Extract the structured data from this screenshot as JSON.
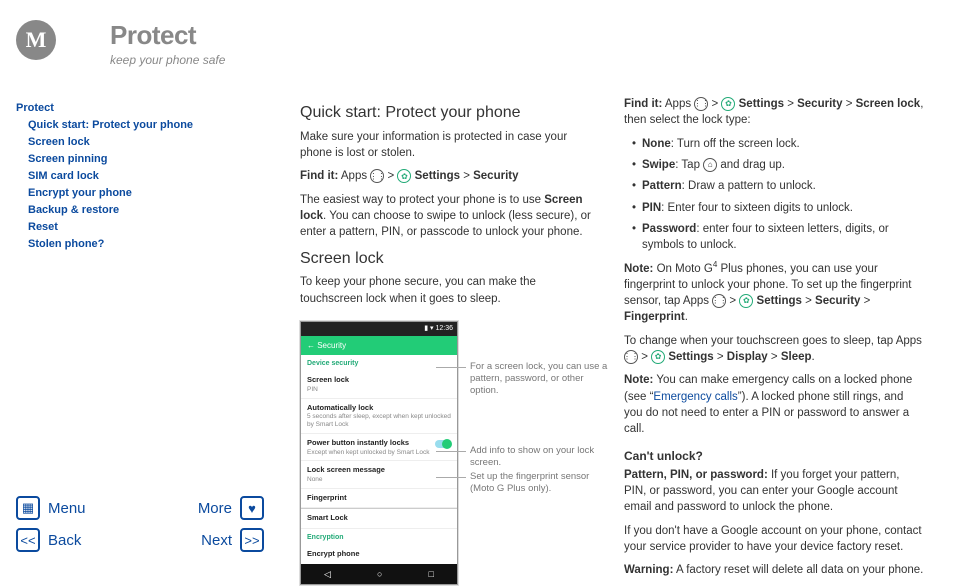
{
  "header": {
    "title": "Protect",
    "subtitle": "keep your phone safe"
  },
  "toc": {
    "head": "Protect",
    "items": [
      "Quick start: Protect your phone",
      "Screen lock",
      "Screen pinning",
      "SIM card lock",
      "Encrypt your phone",
      "Backup & restore",
      "Reset",
      "Stolen phone?"
    ]
  },
  "nav": {
    "menu": "Menu",
    "more": "More",
    "back": "Back",
    "next": "Next"
  },
  "col1": {
    "h_quick": "Quick start: Protect your phone",
    "p_intro": "Make sure your information is protected in case your phone is lost or stolen.",
    "findit_label": "Find it:",
    "findit_apps": "Apps",
    "findit_settings": "Settings",
    "findit_security": "Security",
    "p_easiest1": "The easiest way to protect your phone is to use ",
    "screen_lock_bold": "Screen lock",
    "p_easiest2": ". You can choose to swipe to unlock (less secure), or enter a pattern, PIN, or passcode to unlock your phone.",
    "h_screenlock": "Screen lock",
    "p_screenlock": "To keep your phone secure, you can make the touchscreen lock when it goes to sleep."
  },
  "phone": {
    "time": "12:36",
    "appbar": "←   Security",
    "sect1": "Device security",
    "r1_t": "Screen lock",
    "r1_s": "PIN",
    "r2_t": "Automatically lock",
    "r2_s": "5 seconds after sleep, except when kept unlocked by Smart Lock",
    "r3_t": "Power button instantly locks",
    "r3_s": "Except when kept unlocked by Smart Lock",
    "r4_t": "Lock screen message",
    "r4_s": "None",
    "r5_t": "Fingerprint",
    "r6_t": "Smart Lock",
    "sect2": "Encryption",
    "r7_t": "Encrypt phone"
  },
  "callouts": {
    "c1": "For a screen lock, you can use a pattern, password, or other option.",
    "c2": "Add info to show on your lock screen.",
    "c3": "Set up the fingerprint sensor (Moto G Plus only)."
  },
  "col2": {
    "findit_label": "Find it:",
    "apps": "Apps",
    "settings": "Settings",
    "security": "Security",
    "screenlock": "Screen lock",
    "then": ", then select the lock type:",
    "b_none_l": "None",
    "b_none_t": ": Turn off the screen lock.",
    "b_swipe_l": "Swipe",
    "b_swipe_t1": ": Tap ",
    "b_swipe_t2": " and drag up.",
    "b_pattern_l": "Pattern",
    "b_pattern_t": ": Draw a pattern to unlock.",
    "b_pin_l": "PIN",
    "b_pin_t": ": Enter four to sixteen digits to unlock.",
    "b_pw_l": "Password",
    "b_pw_t": ": enter four to sixteen letters, digits, or symbols to unlock.",
    "note1_l": "Note:",
    "note1_t1": " On Moto G",
    "note1_sup": "4",
    "note1_t2": " Plus phones, you can use your fingerprint to unlock your phone. To set up the fingerprint sensor, tap Apps ",
    "fingerprint": "Fingerprint",
    "p_sleep1": "To change when your touchscreen goes to sleep, tap Apps ",
    "display": "Display",
    "sleep": "Sleep",
    "note2_l": "Note:",
    "note2_t1": " You can make emergency calls on a locked phone (see “",
    "emerg": "Emergency calls",
    "note2_t2": "”). A locked phone still rings, and you do not need to enter a PIN or password to answer a call.",
    "h_cant": "Can't unlock?",
    "p_forgot_l": "Pattern, PIN, or password:",
    "p_forgot_t": " If you forget your pattern, PIN, or password, you can enter your Google account email and password to unlock the phone.",
    "p_nogoog": "If you don't have a Google account on your phone, contact your service provider to have your device factory reset.",
    "warn_l": "Warning:",
    "warn_t": " A factory reset will delete all data on your phone."
  }
}
